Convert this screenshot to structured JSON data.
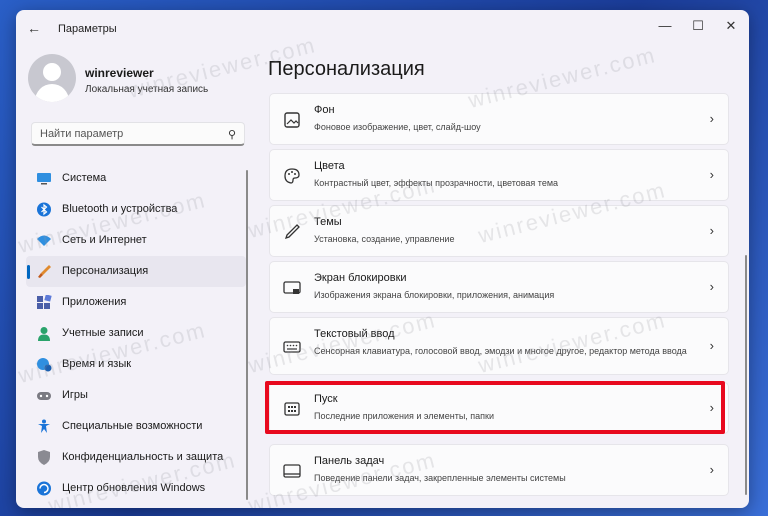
{
  "window": {
    "title": "Параметры"
  },
  "profile": {
    "name": "winreviewer",
    "subtitle": "Локальная учетная запись"
  },
  "search": {
    "placeholder": "Найти параметр"
  },
  "sidebar": {
    "items": [
      {
        "label": "Система",
        "icon": "monitor-icon"
      },
      {
        "label": "Bluetooth и устройства",
        "icon": "bluetooth-icon"
      },
      {
        "label": "Сеть и Интернет",
        "icon": "wifi-icon"
      },
      {
        "label": "Персонализация",
        "icon": "brush-icon",
        "active": true
      },
      {
        "label": "Приложения",
        "icon": "apps-icon"
      },
      {
        "label": "Учетные записи",
        "icon": "account-icon"
      },
      {
        "label": "Время и язык",
        "icon": "globe-clock-icon"
      },
      {
        "label": "Игры",
        "icon": "gamepad-icon"
      },
      {
        "label": "Специальные возможности",
        "icon": "accessibility-icon"
      },
      {
        "label": "Конфиденциальность и защита",
        "icon": "shield-icon"
      },
      {
        "label": "Центр обновления Windows",
        "icon": "update-icon"
      }
    ]
  },
  "main": {
    "title": "Персонализация",
    "cards": [
      {
        "title": "Фон",
        "desc": "Фоновое изображение, цвет, слайд-шоу",
        "icon": "image-icon"
      },
      {
        "title": "Цвета",
        "desc": "Контрастный цвет, эффекты прозрачности, цветовая тема",
        "icon": "palette-icon"
      },
      {
        "title": "Темы",
        "desc": "Установка, создание, управление",
        "icon": "pen-icon"
      },
      {
        "title": "Экран блокировки",
        "desc": "Изображения экрана блокировки, приложения, анимация",
        "icon": "lock-screen-icon"
      },
      {
        "title": "Текстовый ввод",
        "desc": "Сенсорная клавиатура, голосовой ввод, эмодзи и многое другое, редактор метода ввода",
        "icon": "keyboard-icon"
      },
      {
        "title": "Пуск",
        "desc": "Последние приложения и элементы, папки",
        "icon": "start-icon"
      },
      {
        "title": "Панель задач",
        "desc": "Поведение панели задач, закрепленные элементы системы",
        "icon": "taskbar-icon"
      }
    ]
  },
  "watermark": "winreviewer.com",
  "colors": {
    "accent": "#0067c0",
    "highlight": "#e8091e"
  }
}
